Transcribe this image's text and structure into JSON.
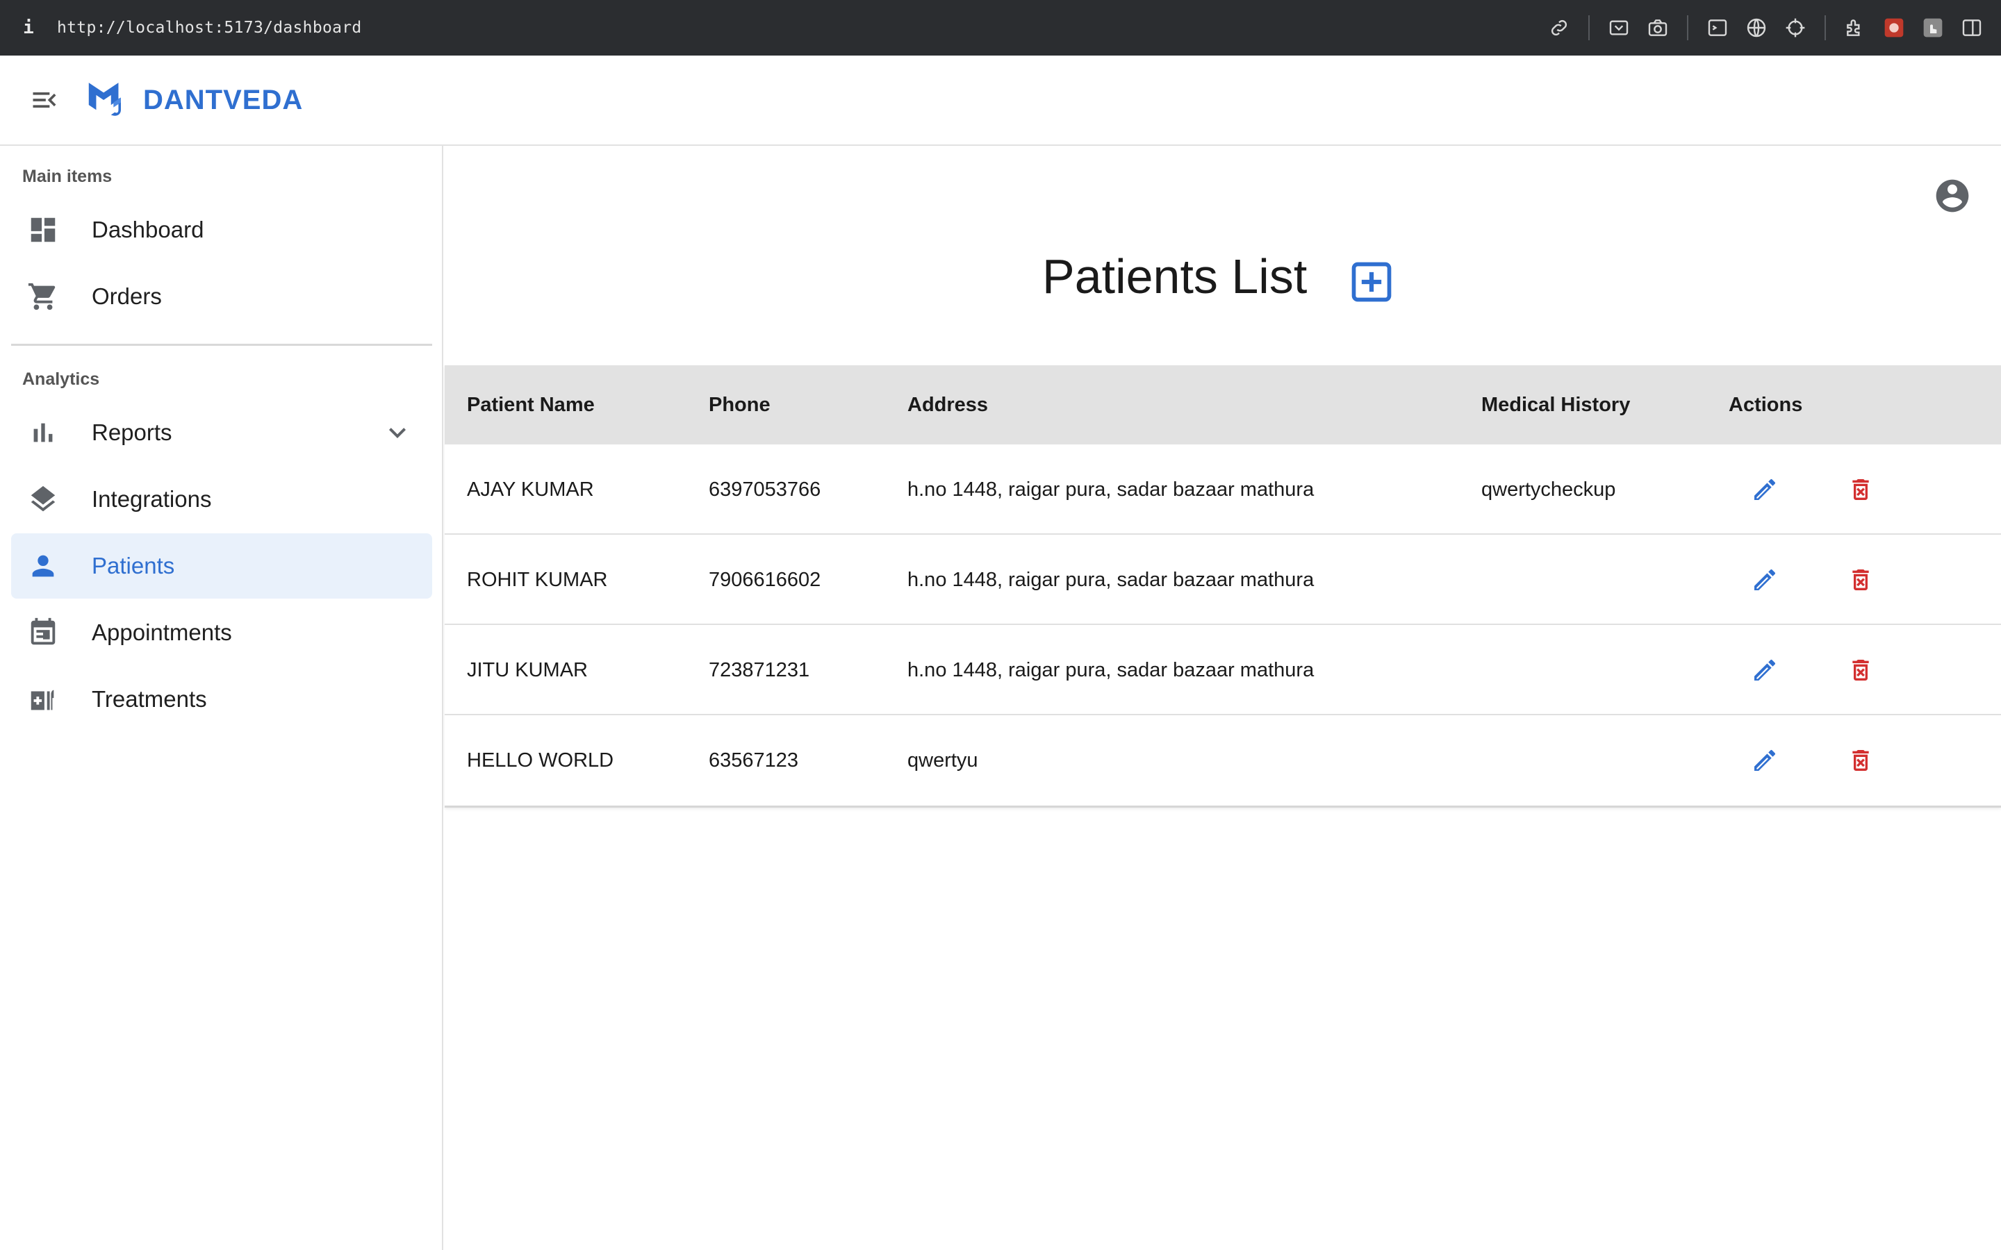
{
  "browser": {
    "info_glyph": "i",
    "url": "http://localhost:5173/dashboard",
    "tool_icons": [
      "link-icon",
      "screenshot-area-icon",
      "camera-icon",
      "terminal-icon",
      "globe-icon",
      "crosshair-icon",
      "extensions-icon",
      "extension-red-icon",
      "extension-hand-icon",
      "sidebar-toggle-icon"
    ]
  },
  "header": {
    "brand": "DANTVEDA",
    "brand_color": "#2f6fd0"
  },
  "sidebar": {
    "section_main": "Main items",
    "section_analytics": "Analytics",
    "main_items": [
      {
        "label": "Dashboard",
        "icon": "dashboard-icon"
      },
      {
        "label": "Orders",
        "icon": "cart-icon"
      }
    ],
    "analytics_items": [
      {
        "label": "Reports",
        "icon": "bar-chart-icon",
        "expandable": true
      },
      {
        "label": "Integrations",
        "icon": "layers-icon"
      },
      {
        "label": "Patients",
        "icon": "person-icon",
        "active": true
      },
      {
        "label": "Appointments",
        "icon": "calendar-icon"
      },
      {
        "label": "Treatments",
        "icon": "medical-services-icon"
      }
    ]
  },
  "main": {
    "title": "Patients List",
    "table": {
      "headers": [
        "Patient Name",
        "Phone",
        "Address",
        "Medical History",
        "Actions"
      ],
      "rows": [
        {
          "name": "AJAY KUMAR",
          "phone": "6397053766",
          "address": "h.no 1448, raigar pura, sadar bazaar mathura",
          "history": "qwertycheckup"
        },
        {
          "name": "ROHIT KUMAR",
          "phone": "7906616602",
          "address": "h.no 1448, raigar pura, sadar bazaar mathura",
          "history": ""
        },
        {
          "name": "JITU KUMAR",
          "phone": "723871231",
          "address": "h.no 1448, raigar pura, sadar bazaar mathura",
          "history": ""
        },
        {
          "name": "HELLO WORLD",
          "phone": "63567123",
          "address": "qwertyu",
          "history": ""
        }
      ]
    },
    "colors": {
      "edit": "#2f6fd0",
      "delete": "#d32f2f",
      "header_bg": "#e2e2e2",
      "active_nav_bg": "#e9f1fb"
    }
  }
}
